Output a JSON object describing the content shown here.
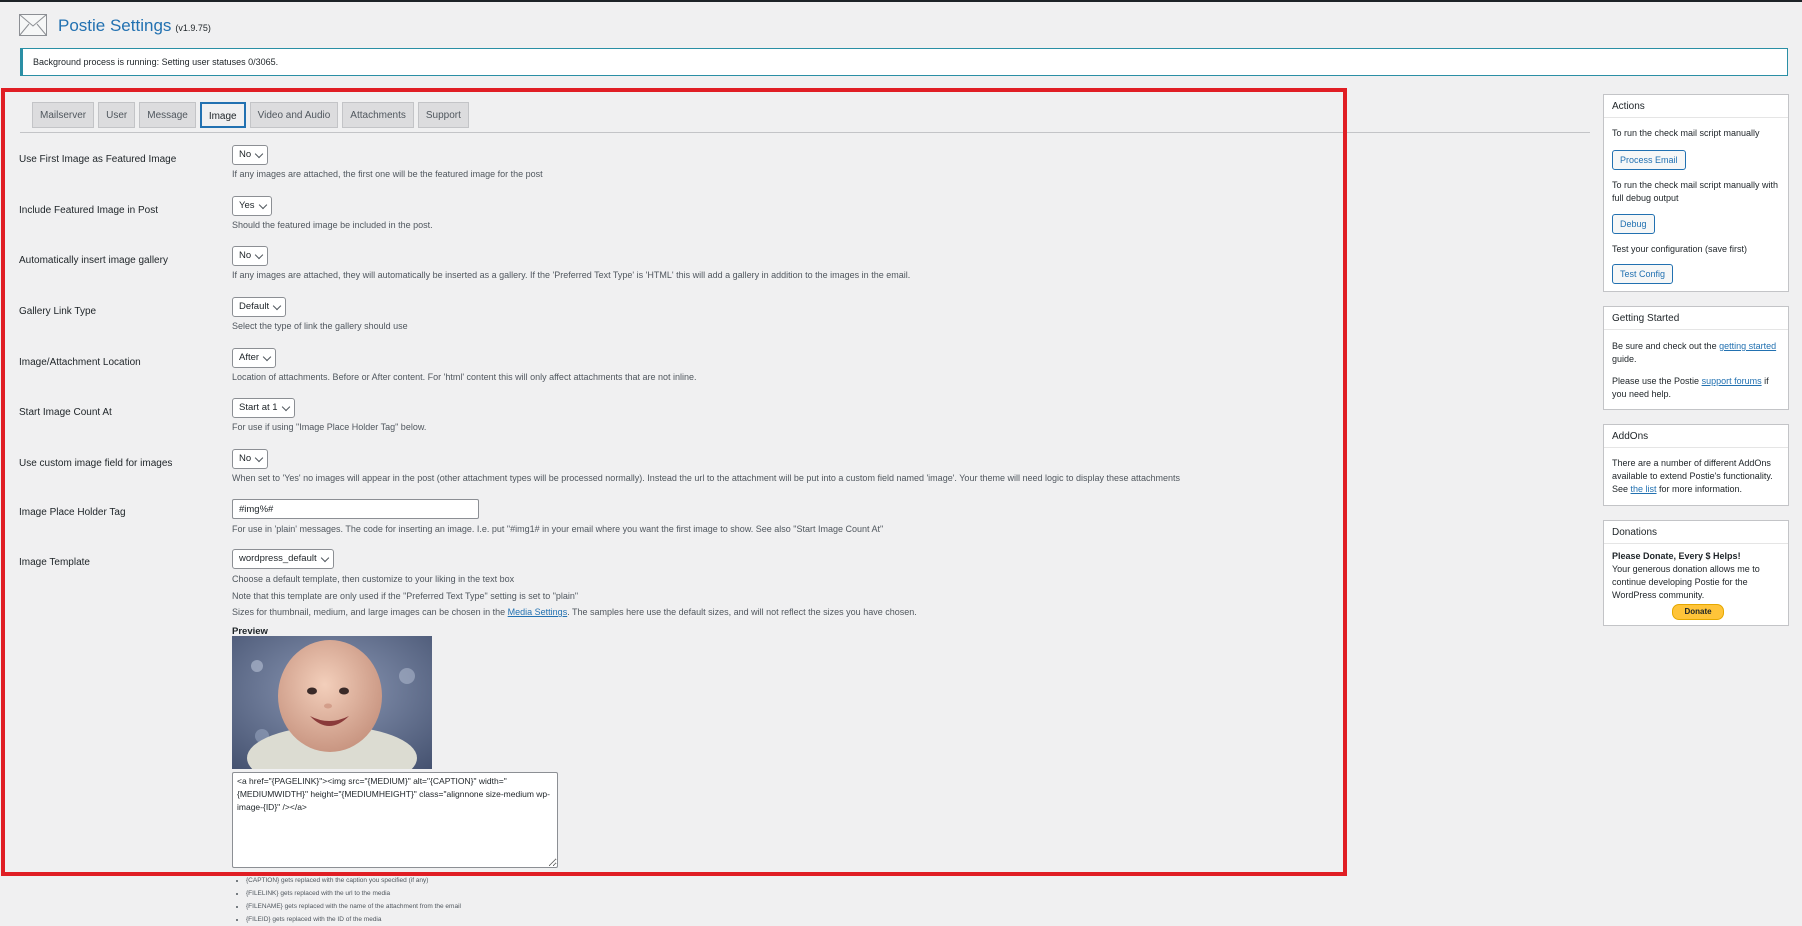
{
  "header": {
    "title": "Postie Settings",
    "version": "(v1.9.75)",
    "icon": "envelope-icon"
  },
  "notice": {
    "text": "Background process is running: Setting user statuses 0/3065."
  },
  "tabs": [
    {
      "label": "Mailserver",
      "active": false
    },
    {
      "label": "User",
      "active": false
    },
    {
      "label": "Message",
      "active": false
    },
    {
      "label": "Image",
      "active": true
    },
    {
      "label": "Video and Audio",
      "active": false
    },
    {
      "label": "Attachments",
      "active": false
    },
    {
      "label": "Support",
      "active": false
    }
  ],
  "settings": {
    "featured_first": {
      "label": "Use First Image as Featured Image",
      "value": "No",
      "desc": "If any images are attached, the first one will be the featured image for the post"
    },
    "include_featured": {
      "label": "Include Featured Image in Post",
      "value": "Yes",
      "desc": "Should the featured image be included in the post."
    },
    "auto_gallery": {
      "label": "Automatically insert image gallery",
      "value": "No",
      "desc": "If any images are attached, they will automatically be inserted as a gallery. If the 'Preferred Text Type' is 'HTML' this will add a gallery in addition to the images in the email."
    },
    "gallery_link": {
      "label": "Gallery Link Type",
      "value": "Default",
      "desc": "Select the type of link the gallery should use"
    },
    "attachment_location": {
      "label": "Image/Attachment Location",
      "value": "After",
      "desc": "Location of attachments. Before or After content. For 'html' content this will only affect attachments that are not inline."
    },
    "start_count": {
      "label": "Start Image Count At",
      "value": "Start at 1",
      "desc": "For use if using \"Image Place Holder Tag\" below."
    },
    "custom_field": {
      "label": "Use custom image field for images",
      "value": "No",
      "desc": "When set to 'Yes' no images will appear in the post (other attachment types will be processed normally). Instead the url to the attachment will be put into a custom field named 'image'. Your theme will need logic to display these attachments"
    },
    "placeholder_tag": {
      "label": "Image Place Holder Tag",
      "value": "#img%#",
      "desc": "For use in 'plain' messages. The code for inserting an image. I.e. put \"#img1# in your email where you want the first image to show. See also \"Start Image Count At\""
    },
    "template": {
      "label": "Image Template",
      "value": "wordpress_default",
      "desc1": "Choose a default template, then customize to your liking in the text box",
      "desc2": "Note that this template are only used if the \"Preferred Text Type\" setting is set to \"plain\"",
      "desc3_pre": "Sizes for thumbnail, medium, and large images can be chosen in the ",
      "desc3_link": "Media Settings",
      "desc3_post": ". The samples here use the default sizes, and will not reflect the sizes you have chosen.",
      "preview_label": "Preview",
      "code": "<a href=\"{PAGELINK}\"><img src=\"{MEDIUM}\" alt=\"{CAPTION}\" width=\"{MEDIUMWIDTH}\" height=\"{MEDIUMHEIGHT}\" class=\"alignnone size-medium wp-image-{ID}\" /></a>"
    }
  },
  "tags_help": [
    "{CAPTION} gets replaced with the caption you specified (if any)",
    "{FILELINK} gets replaced with the url to the media",
    "{FILENAME} gets replaced with the name of the attachment from the email",
    "{FILEID} gets replaced with the ID of the media"
  ],
  "sidebar": {
    "actions": {
      "title": "Actions",
      "text1": "To run the check mail script manually",
      "btn1": "Process Email",
      "text2": "To run the check mail script manually with full debug output",
      "btn2": "Debug",
      "text3": "Test your configuration (save first)",
      "btn3": "Test Config"
    },
    "getting_started": {
      "title": "Getting Started",
      "text1_pre": "Be sure and check out the ",
      "text1_link": "getting started",
      "text1_post": " guide.",
      "text2_pre": "Please use the Postie ",
      "text2_link": "support forums",
      "text2_post": " if you need help."
    },
    "addons": {
      "title": "AddOns",
      "text_pre": "There are a number of different AddOns available to extend Postie's functionality. See ",
      "text_link": "the list",
      "text_post": " for more information."
    },
    "donations": {
      "title": "Donations",
      "headline": "Please Donate, Every $ Helps!",
      "text": "Your generous donation allows me to continue developing Postie for the WordPress community.",
      "btn": "Donate"
    }
  }
}
